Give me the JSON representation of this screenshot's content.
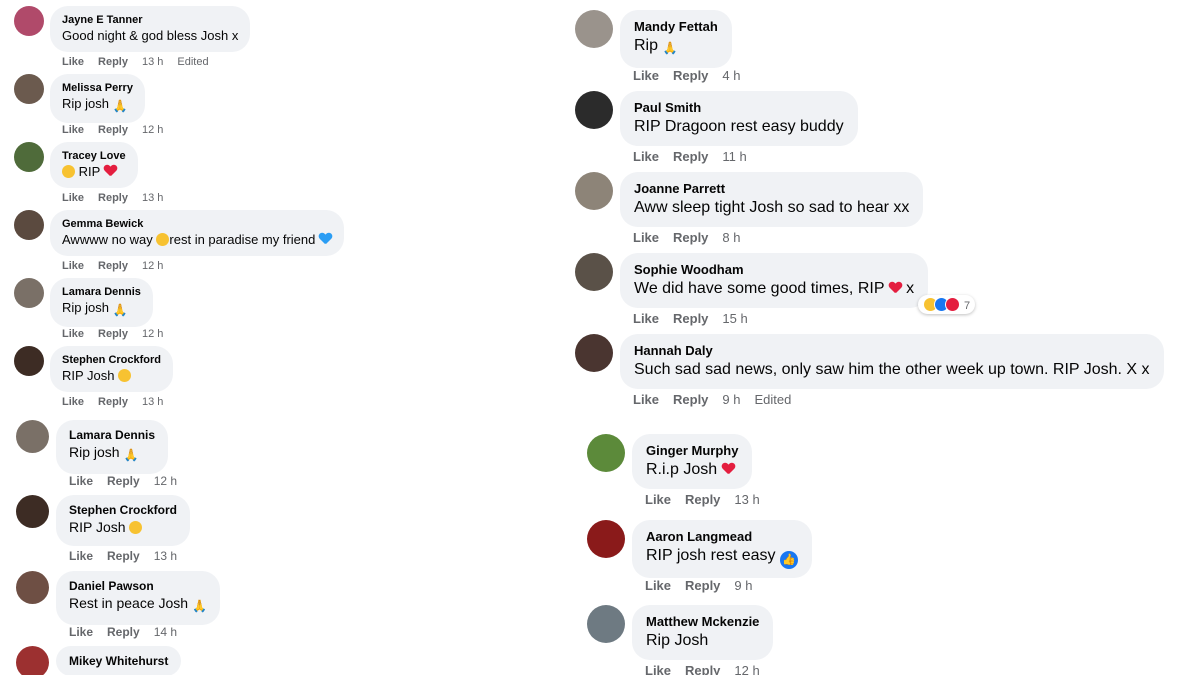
{
  "colors": {
    "bubble": "#f0f2f5",
    "meta": "#65676b",
    "like_blue": "#1877f2",
    "heart_red": "#e41e3f"
  },
  "left_comments": [
    {
      "name": "Jayne E Tanner",
      "text": "Good night & god bless Josh x",
      "like": "Like",
      "reply": "Reply",
      "time": "13 h",
      "edited": "Edited",
      "avatar_color": "#b04a6a"
    },
    {
      "name": "Melissa Perry",
      "text": "Rip josh",
      "like": "Like",
      "reply": "Reply",
      "time": "12 h",
      "avatar_color": "#6b5a4e",
      "emoji": "folded-hands-emoji"
    },
    {
      "name": "Tracey Love",
      "text": "RIP",
      "like": "Like",
      "reply": "Reply",
      "time": "13 h",
      "avatar_color": "#4f6b3a",
      "emoji": "sad-face-emoji,red-heart-emoji"
    },
    {
      "name": "Gemma Bewick",
      "text": "Awwww no way",
      "text2": "rest in paradise my friend",
      "like": "Like",
      "reply": "Reply",
      "time": "12 h",
      "avatar_color": "#5b4a3f",
      "emoji": "disappointed-face-emoji,blue-heart-emoji"
    },
    {
      "name": "Lamara Dennis",
      "text": "Rip josh",
      "like": "Like",
      "reply": "Reply",
      "time": "12 h",
      "avatar_color": "#7a7067",
      "emoji": "folded-hands-emoji"
    },
    {
      "name": "Stephen Crockford",
      "text": "RIP Josh",
      "like": "Like",
      "reply": "Reply",
      "time": "13 h",
      "avatar_color": "#3d2c24",
      "emoji": "sad-face-emoji"
    },
    {
      "name": "Lamara Dennis",
      "text": "Rip josh",
      "like": "Like",
      "reply": "Reply",
      "time": "12 h",
      "avatar_color": "#7a7067",
      "emoji": "folded-hands-emoji"
    },
    {
      "name": "Stephen Crockford",
      "text": "RIP Josh",
      "like": "Like",
      "reply": "Reply",
      "time": "13 h",
      "avatar_color": "#3d2c24",
      "emoji": "sad-face-emoji"
    },
    {
      "name": "Daniel Pawson",
      "text": "Rest in peace Josh",
      "like": "Like",
      "reply": "Reply",
      "time": "14 h",
      "avatar_color": "#6e4f44",
      "emoji": "folded-hands-emoji"
    },
    {
      "name": "Mikey Whitehurst",
      "avatar_color": "#9c3030"
    }
  ],
  "right_comments": [
    {
      "name": "Mandy Fettah",
      "text": "Rip",
      "like": "Like",
      "reply": "Reply",
      "time": "4 h",
      "avatar_color": "#9a938c",
      "emoji": "folded-hands-emoji"
    },
    {
      "name": "Paul Smith",
      "text": "RIP Dragoon rest easy buddy",
      "like": "Like",
      "reply": "Reply",
      "time": "11 h",
      "avatar_color": "#2b2b2b"
    },
    {
      "name": "Joanne Parrett",
      "text": "Aww sleep tight Josh so sad to hear xx",
      "like": "Like",
      "reply": "Reply",
      "time": "8 h",
      "avatar_color": "#8d8478"
    },
    {
      "name": "Sophie Woodham",
      "text": "We did have some good times, RIP",
      "text_after": "x",
      "like": "Like",
      "reply": "Reply",
      "time": "15 h",
      "avatar_color": "#5a5148",
      "emoji": "red-heart-emoji",
      "reaction_count": "7"
    },
    {
      "name": "Hannah Daly",
      "text": "Such sad sad news, only saw him the other week up town. RIP Josh. X x",
      "like": "Like",
      "reply": "Reply",
      "time": "9 h",
      "edited": "Edited",
      "avatar_color": "#4a3530"
    },
    {
      "name": "Ginger Murphy",
      "text": "R.i.p Josh",
      "like": "Like",
      "reply": "Reply",
      "time": "13 h",
      "avatar_color": "#5c8a3a",
      "emoji": "red-heart-emoji"
    },
    {
      "name": "Aaron Langmead",
      "text": "RIP josh rest easy",
      "like": "Like",
      "reply": "Reply",
      "time": "9 h",
      "avatar_color": "#8a1a1a",
      "emoji": "like-reaction-icon"
    },
    {
      "name": "Matthew Mckenzie",
      "text": "Rip Josh",
      "like": "Like",
      "reply": "Reply",
      "time": "12 h",
      "avatar_color": "#6e7a82"
    }
  ]
}
